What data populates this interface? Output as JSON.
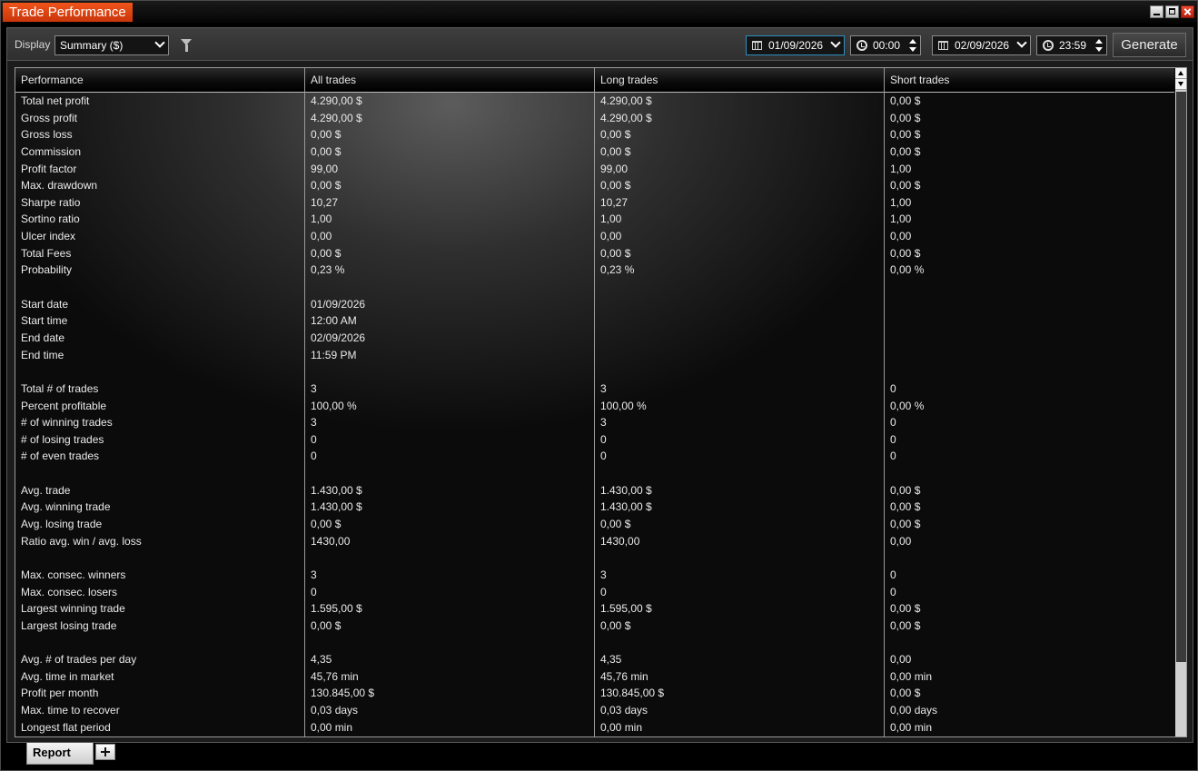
{
  "window": {
    "title": "Trade Performance"
  },
  "toolbar": {
    "display_label": "Display",
    "display_value": "Summary ($)",
    "start_date": "01/09/2026",
    "start_time": "00:00",
    "end_date": "02/09/2026",
    "end_time": "23:59",
    "generate_label": "Generate"
  },
  "table": {
    "headers": [
      "Performance",
      "All trades",
      "Long trades",
      "Short trades"
    ],
    "rows": [
      [
        "Total net profit",
        "4.290,00 $",
        "4.290,00 $",
        "0,00 $"
      ],
      [
        "Gross profit",
        "4.290,00 $",
        "4.290,00 $",
        "0,00 $"
      ],
      [
        "Gross loss",
        "0,00 $",
        "0,00 $",
        "0,00 $"
      ],
      [
        "Commission",
        "0,00 $",
        "0,00 $",
        "0,00 $"
      ],
      [
        "Profit factor",
        "99,00",
        "99,00",
        "1,00"
      ],
      [
        "Max. drawdown",
        "0,00 $",
        "0,00 $",
        "0,00 $"
      ],
      [
        "Sharpe ratio",
        "10,27",
        "10,27",
        "1,00"
      ],
      [
        "Sortino ratio",
        "1,00",
        "1,00",
        "1,00"
      ],
      [
        "Ulcer index",
        "0,00",
        "0,00",
        "0,00"
      ],
      [
        "Total Fees",
        "0,00 $",
        "0,00 $",
        "0,00 $"
      ],
      [
        "Probability",
        "0,23 %",
        "0,23 %",
        "0,00 %"
      ],
      [
        "",
        "",
        "",
        ""
      ],
      [
        "Start date",
        "01/09/2026",
        "",
        ""
      ],
      [
        "Start time",
        "12:00 AM",
        "",
        ""
      ],
      [
        "End date",
        "02/09/2026",
        "",
        ""
      ],
      [
        "End time",
        "11:59 PM",
        "",
        ""
      ],
      [
        "",
        "",
        "",
        ""
      ],
      [
        "Total # of trades",
        "3",
        "3",
        "0"
      ],
      [
        "Percent profitable",
        "100,00 %",
        "100,00 %",
        "0,00 %"
      ],
      [
        "# of winning trades",
        "3",
        "3",
        "0"
      ],
      [
        "# of losing trades",
        "0",
        "0",
        "0"
      ],
      [
        "# of even trades",
        "0",
        "0",
        "0"
      ],
      [
        "",
        "",
        "",
        ""
      ],
      [
        "Avg. trade",
        "1.430,00 $",
        "1.430,00 $",
        "0,00 $"
      ],
      [
        "Avg. winning trade",
        "1.430,00 $",
        "1.430,00 $",
        "0,00 $"
      ],
      [
        "Avg. losing trade",
        "0,00 $",
        "0,00 $",
        "0,00 $"
      ],
      [
        "Ratio avg. win / avg. loss",
        "1430,00",
        "1430,00",
        "0,00"
      ],
      [
        "",
        "",
        "",
        ""
      ],
      [
        "Max. consec. winners",
        "3",
        "3",
        "0"
      ],
      [
        "Max. consec. losers",
        "0",
        "0",
        "0"
      ],
      [
        "Largest winning trade",
        "1.595,00 $",
        "1.595,00 $",
        "0,00 $"
      ],
      [
        "Largest losing trade",
        "0,00 $",
        "0,00 $",
        "0,00 $"
      ],
      [
        "",
        "",
        "",
        ""
      ],
      [
        "Avg. # of trades per day",
        "4,35",
        "4,35",
        "0,00"
      ],
      [
        "Avg. time in market",
        "45,76 min",
        "45,76 min",
        "0,00 min"
      ],
      [
        "Profit per month",
        "130.845,00 $",
        "130.845,00 $",
        "0,00 $"
      ],
      [
        "Max. time to recover",
        "0,03 days",
        "0,03 days",
        "0,00 days"
      ],
      [
        "Longest flat period",
        "0,00 min",
        "0,00 min",
        "0,00 min"
      ]
    ]
  },
  "tabs": {
    "report_label": "Report"
  },
  "colors": {
    "title_accent": "#e8481a",
    "background": "#000000",
    "grid_line": "#9a9a9a"
  },
  "icons": [
    "filter-icon",
    "calendar-icon",
    "clock-icon",
    "chevron-down-icon",
    "spinner-icon",
    "minimize-icon",
    "maximize-icon",
    "close-icon",
    "add-tab-icon"
  ]
}
